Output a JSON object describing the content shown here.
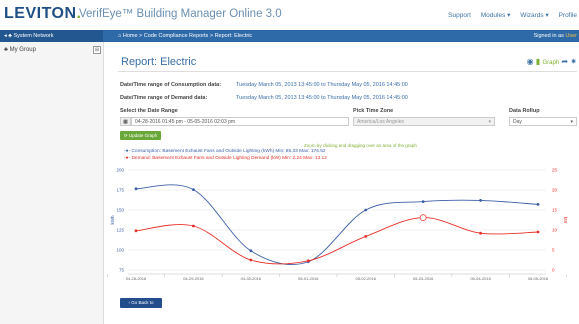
{
  "header": {
    "logo": "LEVITON",
    "app_title": "VerifEye™ Building Manager Online 3.0",
    "nav": [
      "Support",
      "Modules ▾",
      "Wizards ▾",
      "Profile"
    ]
  },
  "navbar": {
    "system_network": "System Network",
    "breadcrumb": "Home > Code Compliance Reports > Report: Electric",
    "signed_in_prefix": "Signed in as",
    "signed_in_user": "User"
  },
  "sidebar": {
    "group_label": "My Group",
    "toggle": "⊞"
  },
  "page": {
    "title": "Report: Electric",
    "graph_label": "Graph",
    "consumption_label": "Date/Time range of Consumption data:",
    "consumption_value": "Tuesday March 05, 2013 13:45:00 to Thursday May 05, 2016 14:45:00",
    "demand_label": "Date/Time range of Demand data:",
    "demand_value": "Tuesday March 05, 2013 13:45:00 to Thursday May 05, 2016 14:45:00",
    "date_range_label": "Select the Date Range",
    "date_range_value": "04-28-2016 01:45 pm - 05-05-2016 02:03 pm",
    "timezone_label": "Pick Time Zone",
    "timezone_value": "America/Los Angeles",
    "rollup_label": "Data Rollup",
    "rollup_value": "Day",
    "update_button": "Update Graph",
    "zoom_hint": "Zoom by clicking and dragging over an area of the graph",
    "back_button": "Go Back to Reports"
  },
  "chart_data": {
    "type": "line",
    "x": [
      "04-28-2016",
      "04-29-2016",
      "04-30-2016",
      "05-01-2016",
      "05-02-2016",
      "05-03-2016",
      "05-04-2016",
      "05-05-2016"
    ],
    "series": [
      {
        "name": "Consumption: Basement Exhaust Fans and Outside Lighting (kWh) Min: 85.33 Max: 176.52",
        "axis": "left",
        "color": "#3c5fa6",
        "values": [
          176.5,
          175.5,
          99.0,
          85.3,
          150.0,
          160.5,
          162.0,
          157.0
        ]
      },
      {
        "name": "Demand: Basement Exhaust Fans and Outside Lighting Demand (kW) Min: 2.24 Max: 13.12",
        "axis": "right",
        "color": "#e8302a",
        "values": [
          9.8,
          11.0,
          2.5,
          2.3,
          8.4,
          13.1,
          9.2,
          9.5
        ]
      }
    ],
    "left_axis": {
      "label": "kWh",
      "ylim": [
        75,
        200
      ],
      "ticks": [
        "75",
        "100",
        "125",
        "150",
        "175",
        "200"
      ]
    },
    "right_axis": {
      "label": "kW",
      "ylim": [
        0,
        25
      ],
      "ticks": [
        "0",
        "5",
        "10",
        "15",
        "20",
        "25"
      ]
    },
    "grid": "horizontal"
  }
}
